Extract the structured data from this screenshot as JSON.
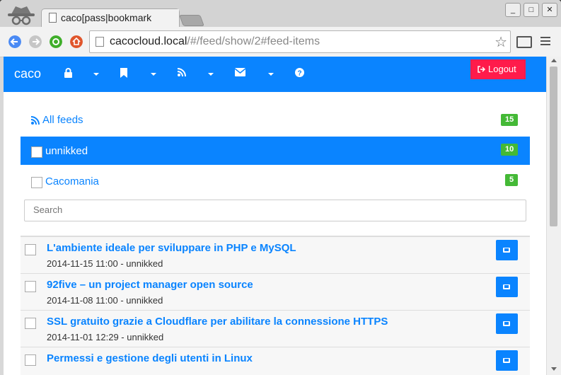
{
  "browser": {
    "tab_title": "caco[pass|bookmark",
    "url_host": "cacocloud.local",
    "url_rest": "/#/feed/show/2#feed-items",
    "window_buttons": [
      "_",
      "□",
      "✕"
    ]
  },
  "navbar": {
    "brand": "caco",
    "logout_label": "Logout"
  },
  "feeds": [
    {
      "label": "All feeds",
      "count": "15"
    },
    {
      "label": "unnikked",
      "count": "10"
    },
    {
      "label": "Cacomania",
      "count": "5"
    }
  ],
  "search": {
    "placeholder": "Search"
  },
  "items": [
    {
      "title": "L'ambiente ideale per sviluppare in PHP e MySQL",
      "meta": "2014-11-15 11:00 - unnikked"
    },
    {
      "title": "92five – un project manager open source",
      "meta": "2014-11-08 11:00 - unnikked"
    },
    {
      "title": "SSL gratuito grazie a Cloudflare per abilitare la connessione HTTPS",
      "meta": "2014-11-01 12:29 - unnikked"
    },
    {
      "title": "Permessi e gestione degli utenti in Linux",
      "meta": ""
    }
  ],
  "colors": {
    "primary": "#0a84ff",
    "danger": "#ff1b4b",
    "badge": "#44b936"
  }
}
